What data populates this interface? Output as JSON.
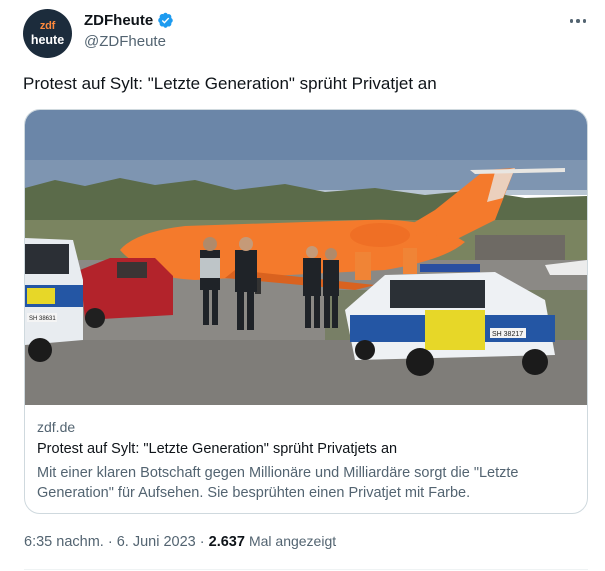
{
  "author": {
    "avatar_line1": "zdf",
    "avatar_line2": "heute",
    "display_name": "ZDFheute",
    "handle": "@ZDFheute",
    "verified_color": "#1d9bf0"
  },
  "tweet": {
    "text": "Protest auf Sylt: \"Letzte Generation\" sprüht Privatjet an"
  },
  "card": {
    "domain": "zdf.de",
    "title": "Protest auf Sylt: \"Letzte Generation\" sprüht Privatjets an",
    "description": "Mit einer klaren Botschaft gegen Millionäre und Milliardäre sorgt die \"Letzte Generation\" für Aufsehen. Sie besprühten einen Privatjet mit Farbe.",
    "image": {
      "plate_left": "SH 38631",
      "plate_right": "SH 38217",
      "jet_color": "#f47a2c"
    }
  },
  "meta": {
    "time": "6:35 nachm.",
    "date": "6. Juni 2023",
    "views_count": "2.637",
    "views_label": "Mal angezeigt",
    "separator": "·"
  },
  "icons": {
    "more": "more-icon",
    "verified": "verified-badge-icon"
  }
}
